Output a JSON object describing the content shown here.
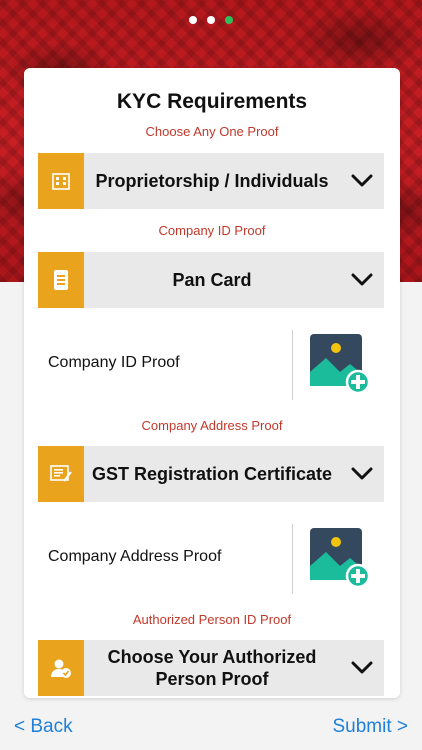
{
  "pager": {
    "count": 3,
    "active_index": 2
  },
  "card": {
    "title": "KYC Requirements",
    "sections": [
      {
        "label": "Choose Any One Proof",
        "dropdown_value": "Proprietorship / Individuals",
        "icon": "building-icon"
      },
      {
        "label": "Company ID Proof",
        "dropdown_value": "Pan Card",
        "icon": "document-icon",
        "upload_label": "Company ID Proof",
        "upload_icon": "add-image-icon"
      },
      {
        "label": "Company Address Proof",
        "dropdown_value": "GST Registration Certificate",
        "icon": "certificate-icon",
        "upload_label": "Company Address Proof",
        "upload_icon": "add-image-icon"
      },
      {
        "label": "Authorized Person ID Proof",
        "dropdown_value": "Choose Your Authorized Person Proof",
        "icon": "verified-person-icon"
      }
    ]
  },
  "footer": {
    "back_label": "< Back",
    "submit_label": "Submit >"
  },
  "colors": {
    "accent_orange": "#e9a31c",
    "label_red": "#c0392b",
    "link_blue": "#1e80d8",
    "pager_active": "#2fbf5c"
  }
}
